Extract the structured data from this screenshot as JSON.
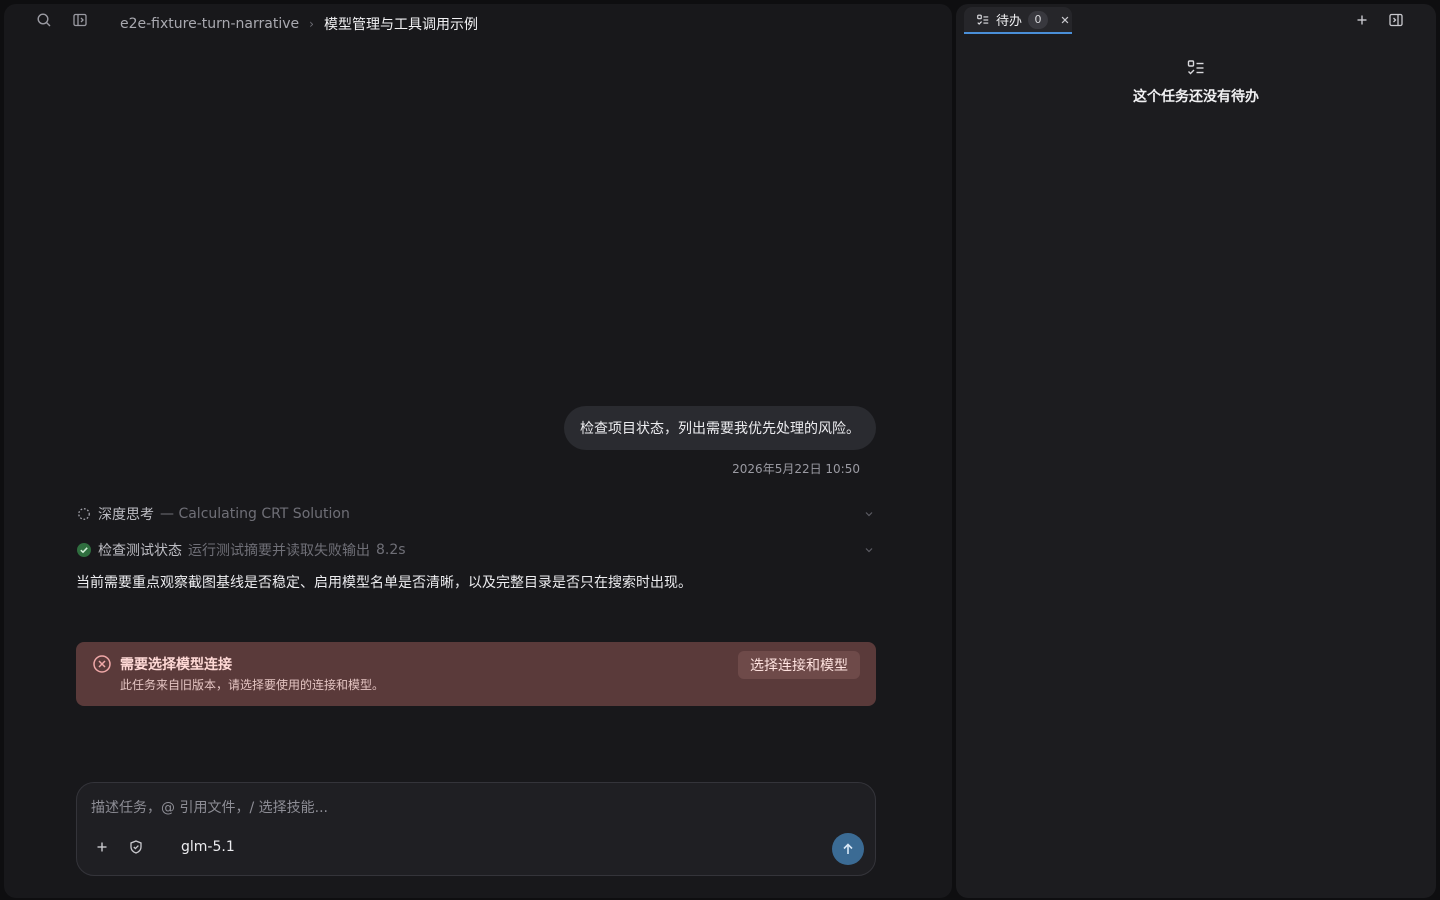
{
  "header": {
    "project": "e2e-fixture-turn-narrative",
    "separator": "›",
    "title": "模型管理与工具调用示例"
  },
  "conversation": {
    "user_message": "检查项目状态，列出需要我优先处理的风险。",
    "timestamp": "2026年5月22日 10:50",
    "steps": [
      {
        "title": "深度思考",
        "detail": "— Calculating CRT Solution",
        "status": "thinking"
      },
      {
        "title": "检查测试状态",
        "detail": "运行测试摘要并读取失败输出",
        "duration": "8.2s",
        "status": "done"
      }
    ],
    "answer": "当前需要重点观察截图基线是否稳定、启用模型名单是否清晰，以及完整目录是否只在搜索时出现。"
  },
  "error": {
    "title": "需要选择模型连接",
    "description": "此任务来自旧版本，请选择要使用的连接和模型。",
    "action_label": "选择连接和模型"
  },
  "composer": {
    "placeholder": "描述任务，@ 引用文件，/ 选择技能...",
    "model": "glm-5.1"
  },
  "todo_panel": {
    "tab_label": "待办",
    "count": "0",
    "empty_text": "这个任务还没有待办"
  },
  "colors": {
    "accent": "#4a8fd8",
    "send_button": "#3b6b94",
    "error_background": "#5a3a3a",
    "success": "#3fa45b"
  }
}
